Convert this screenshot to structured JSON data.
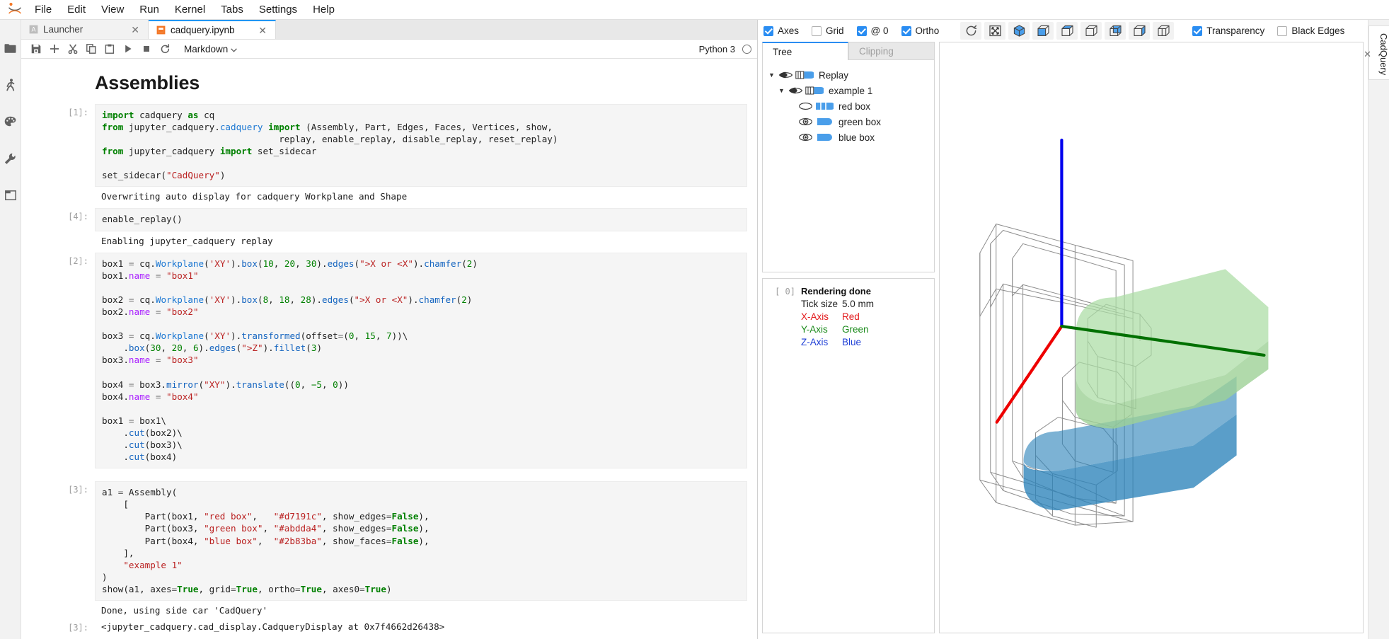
{
  "menubar": {
    "items": [
      "File",
      "Edit",
      "View",
      "Run",
      "Kernel",
      "Tabs",
      "Settings",
      "Help"
    ]
  },
  "left_sidebar": {
    "items": [
      {
        "name": "file-browser-icon",
        "label": "File Browser"
      },
      {
        "name": "running-terminals-icon",
        "label": "Running Terminals and Kernels"
      },
      {
        "name": "palette-icon",
        "label": "Commands"
      },
      {
        "name": "wrench-icon",
        "label": "Property Inspector"
      },
      {
        "name": "open-tabs-icon",
        "label": "Open Tabs"
      }
    ]
  },
  "tabs": [
    {
      "label": "Launcher",
      "icon": "launcher-icon",
      "active": false,
      "close": "✕"
    },
    {
      "label": "cadquery.ipynb",
      "icon": "notebook-icon",
      "active": true,
      "close": "✕"
    }
  ],
  "notebook_toolbar": {
    "buttons": [
      {
        "name": "save-button",
        "icon": "save-icon"
      },
      {
        "name": "insert-cell-button",
        "icon": "plus-icon"
      },
      {
        "name": "cut-cell-button",
        "icon": "scissors-icon"
      },
      {
        "name": "copy-cell-button",
        "icon": "copy-icon"
      },
      {
        "name": "paste-cell-button",
        "icon": "paste-icon"
      },
      {
        "name": "run-cell-button",
        "icon": "play-icon"
      },
      {
        "name": "interrupt-kernel-button",
        "icon": "stop-icon"
      },
      {
        "name": "restart-kernel-button",
        "icon": "restart-icon"
      }
    ],
    "celltype": "Markdown",
    "celltype_caret": "⌄",
    "kernel_name": "Python 3",
    "kernel_status": "idle"
  },
  "notebook": {
    "title": "Assemblies",
    "cells": [
      {
        "prompt": "[1]:",
        "code_html": "<span class=\"k\">import</span> cadquery <span class=\"k\">as</span> cq\n<span class=\"k\">from</span> jupyter_cadquery.<span class=\"nn\">cadquery</span> <span class=\"k\">import</span> (Assembly, Part, Edges, Faces, Vertices, show,\n                                 replay, enable_replay, disable_replay, reset_replay)\n<span class=\"k\">from</span> jupyter_cadquery <span class=\"k\">import</span> set_sidecar\n\nset_sidecar(<span class=\"s\">\"CadQuery\"</span>)",
        "output": "Overwriting auto display for cadquery Workplane and Shape"
      },
      {
        "prompt": "[4]:",
        "code_html": "enable_replay()",
        "output": "Enabling jupyter_cadquery replay"
      },
      {
        "prompt": "[2]:",
        "code_html": "box1 <span class=\"op\">=</span> cq.<span class=\"nn\">Workplane</span>(<span class=\"s\">'XY'</span>).<span class=\"f\">box</span>(<span class=\"num\">10</span>, <span class=\"num\">20</span>, <span class=\"num\">30</span>).<span class=\"f\">edges</span>(<span class=\"s\">\"&gt;X or &lt;X\"</span>).<span class=\"f\">chamfer</span>(<span class=\"num\">2</span>)\nbox1.<span class=\"at\">name</span> <span class=\"op\">=</span> <span class=\"s\">\"box1\"</span>\n\nbox2 <span class=\"op\">=</span> cq.<span class=\"nn\">Workplane</span>(<span class=\"s\">'XY'</span>).<span class=\"f\">box</span>(<span class=\"num\">8</span>, <span class=\"num\">18</span>, <span class=\"num\">28</span>).<span class=\"f\">edges</span>(<span class=\"s\">\"&gt;X or &lt;X\"</span>).<span class=\"f\">chamfer</span>(<span class=\"num\">2</span>)\nbox2.<span class=\"at\">name</span> <span class=\"op\">=</span> <span class=\"s\">\"box2\"</span>\n\nbox3 <span class=\"op\">=</span> cq.<span class=\"nn\">Workplane</span>(<span class=\"s\">'XY'</span>).<span class=\"f\">transformed</span>(offset<span class=\"op\">=</span>(<span class=\"num\">0</span>, <span class=\"num\">15</span>, <span class=\"num\">7</span>))\\\n    .<span class=\"f\">box</span>(<span class=\"num\">30</span>, <span class=\"num\">20</span>, <span class=\"num\">6</span>).<span class=\"f\">edges</span>(<span class=\"s\">\"&gt;Z\"</span>).<span class=\"f\">fillet</span>(<span class=\"num\">3</span>)\nbox3.<span class=\"at\">name</span> <span class=\"op\">=</span> <span class=\"s\">\"box3\"</span>\n\nbox4 <span class=\"op\">=</span> box3.<span class=\"f\">mirror</span>(<span class=\"s\">\"XY\"</span>).<span class=\"f\">translate</span>((<span class=\"num\">0</span>, <span class=\"num\">−5</span>, <span class=\"num\">0</span>))\nbox4.<span class=\"at\">name</span> <span class=\"op\">=</span> <span class=\"s\">\"box4\"</span>\n\nbox1 <span class=\"op\">=</span> box1\\\n    .<span class=\"f\">cut</span>(box2)\\\n    .<span class=\"f\">cut</span>(box3)\\\n    .<span class=\"f\">cut</span>(box4)",
        "output": ""
      },
      {
        "prompt": "[3]:",
        "code_html": "a1 <span class=\"op\">=</span> Assembly(\n    [\n        Part(box1, <span class=\"s\">\"red box\"</span>,   <span class=\"s\">\"#d7191c\"</span>, show_edges<span class=\"op\">=</span><span class=\"k\">False</span>),\n        Part(box3, <span class=\"s\">\"green box\"</span>, <span class=\"s\">\"#abdda4\"</span>, show_edges<span class=\"op\">=</span><span class=\"k\">False</span>),\n        Part(box4, <span class=\"s\">\"blue box\"</span>,  <span class=\"s\">\"#2b83ba\"</span>, show_faces<span class=\"op\">=</span><span class=\"k\">False</span>),\n    ],\n    <span class=\"s\">\"example 1\"</span>\n)\nshow(a1, axes<span class=\"op\">=</span><span class=\"k\">True</span>, grid<span class=\"op\">=</span><span class=\"k\">True</span>, ortho<span class=\"op\">=</span><span class=\"k\">True</span>, axes0<span class=\"op\">=</span><span class=\"k\">True</span>)",
        "output": "Done, using side car 'CadQuery'",
        "result_prompt": "[3]:",
        "result": "<jupyter_cadquery.cad_display.CadqueryDisplay at 0x7f4662d26438>"
      }
    ]
  },
  "sidecar": {
    "toolbar": {
      "checkboxes": [
        {
          "label": "Axes",
          "checked": true,
          "name": "axes-checkbox"
        },
        {
          "label": "Grid",
          "checked": false,
          "name": "grid-checkbox"
        },
        {
          "label": "@ 0",
          "checked": true,
          "name": "axes0-checkbox"
        },
        {
          "label": "Ortho",
          "checked": true,
          "name": "ortho-checkbox"
        }
      ],
      "buttons": [
        {
          "name": "reset-view-button",
          "icon": "reset-camera-icon"
        },
        {
          "name": "fit-view-button",
          "icon": "resize-icon"
        },
        {
          "name": "view-iso-button",
          "icon": "cube-iso-icon"
        },
        {
          "name": "view-front-button",
          "icon": "cube-front-icon"
        },
        {
          "name": "view-rear-button",
          "icon": "cube-rear-icon"
        },
        {
          "name": "view-top-button",
          "icon": "cube-top-icon"
        },
        {
          "name": "view-bottom-button",
          "icon": "cube-bottom-icon"
        },
        {
          "name": "view-left-button",
          "icon": "cube-left-icon"
        },
        {
          "name": "view-right-button",
          "icon": "cube-right-icon"
        }
      ],
      "right_checkboxes": [
        {
          "label": "Transparency",
          "checked": true,
          "name": "transparency-checkbox"
        },
        {
          "label": "Black Edges",
          "checked": false,
          "name": "black-edges-checkbox"
        }
      ]
    },
    "panel_tabs": [
      {
        "label": "Tree",
        "active": true
      },
      {
        "label": "Clipping",
        "active": false
      }
    ],
    "tree": [
      {
        "label": "Replay",
        "indent": 0,
        "caret": "▼",
        "eye": "half",
        "shape": "mixed"
      },
      {
        "label": "example 1",
        "indent": 1,
        "caret": "▼",
        "eye": "half",
        "shape": "mixed"
      },
      {
        "label": "red box",
        "indent": 2,
        "caret": "",
        "eye": "off",
        "shape": "edges"
      },
      {
        "label": "green box",
        "indent": 2,
        "caret": "",
        "eye": "on",
        "shape": "solid"
      },
      {
        "label": "blue box",
        "indent": 2,
        "caret": "",
        "eye": "on",
        "shape": "solid"
      }
    ],
    "info": {
      "index": "[ 0]",
      "status": "Rendering done",
      "rows": [
        {
          "key": "Tick size",
          "value": "5.0 mm",
          "color": "#111111"
        },
        {
          "key": "X-Axis",
          "value": "Red",
          "color": "#e31a1c"
        },
        {
          "key": "Y-Axis",
          "value": "Green",
          "color": "#1a8a1a"
        },
        {
          "key": "Z-Axis",
          "value": "Blue",
          "color": "#1f3fd6"
        }
      ]
    },
    "viewport": {
      "axis_colors": {
        "x": "#ee0000",
        "y": "#007000",
        "z": "#0000ee"
      },
      "part_colors": {
        "green_box": "#abdda4",
        "blue_box": "#2b83ba",
        "red_box_edges": "#9e9e9e"
      }
    },
    "vertical_tab": {
      "label": "CadQuery",
      "close": "✕"
    }
  }
}
